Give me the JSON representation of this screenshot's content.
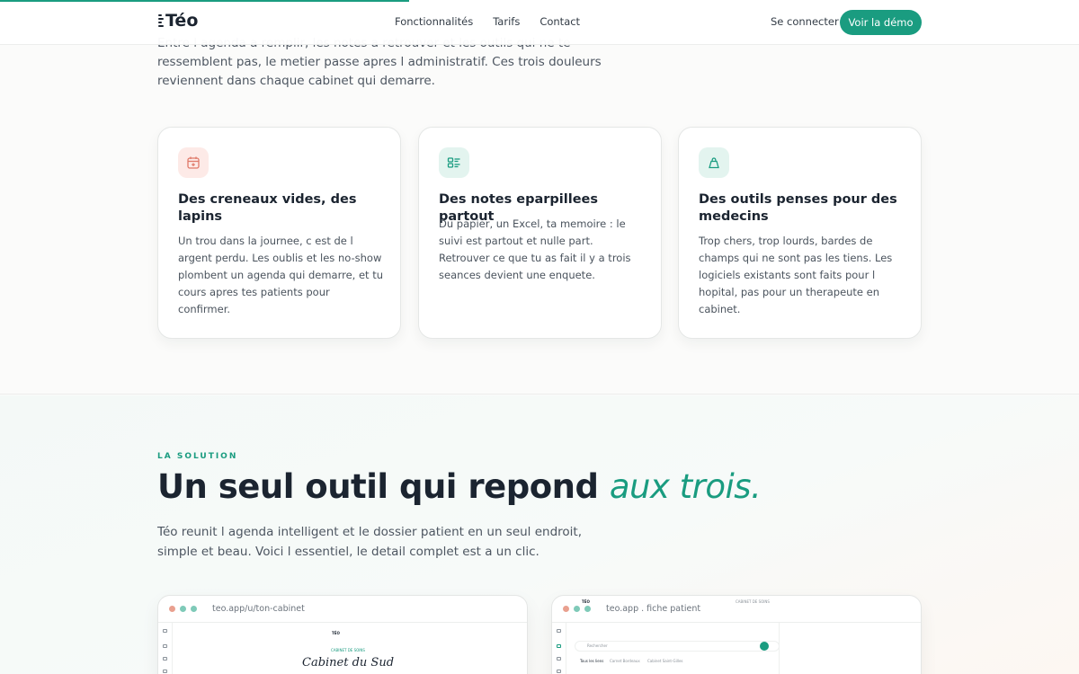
{
  "header": {
    "logo": "Téo",
    "nav": [
      "Fonctionnalités",
      "Tarifs",
      "Contact"
    ],
    "login": "Se connecter",
    "cta": "Voir la démo"
  },
  "problem": {
    "intro": "Entre l agenda a remplir, les notes a retrouver et les outils qui ne te ressemblent pas, le metier passe apres l administratif. Ces trois douleurs reviennent dans chaque cabinet qui demarre.",
    "cards": [
      {
        "icon": "calendar-plus-icon",
        "title": "Des creneaux vides, des lapins",
        "text": "Un trou dans la journee, c est de l argent perdu. Les oublis et les no-show plombent un agenda qui demarre, et tu cours apres tes patients pour confirmer."
      },
      {
        "icon": "notes-icon",
        "title": "Des notes eparpillees partout",
        "text": "Du papier, un Excel, ta memoire : le suivi est partout et nulle part. Retrouver ce que tu as fait il y a trois seances devient une enquete."
      },
      {
        "icon": "tool-icon",
        "title": "Des outils penses pour des medecins",
        "text": "Trop chers, trop lourds, bardes de champs qui ne sont pas les tiens. Les logiciels existants sont faits pour l hopital, pas pour un therapeute en cabinet."
      }
    ]
  },
  "solution": {
    "kicker": "LA SOLUTION",
    "title_main": "Un seul outil qui repond ",
    "title_accent": "aux trois.",
    "text": "Téo reunit l agenda intelligent et le dossier patient en un seul endroit, simple et beau. Voici l essentiel, le detail complet est a un clic."
  },
  "mockups": [
    {
      "url": "teo.app/u/ton-cabinet",
      "brand": "TÉO",
      "small_label": "CABINET DE SOINS",
      "page_title": "Cabinet du Sud"
    },
    {
      "url": "teo.app . fiche patient",
      "brand": "TÉO",
      "top_right": "CABINET DE SOINS",
      "search": "Rechercher",
      "tabs": [
        "Tous les liens",
        "Carnet Bordeaux",
        "Cabinet Saint-Gilles"
      ]
    }
  ],
  "colors": {
    "accent": "#1a9c80",
    "text": "#1b2430",
    "card_icon_red_bg": "#fdeae7",
    "card_icon_green_bg": "#e3f4ef"
  }
}
